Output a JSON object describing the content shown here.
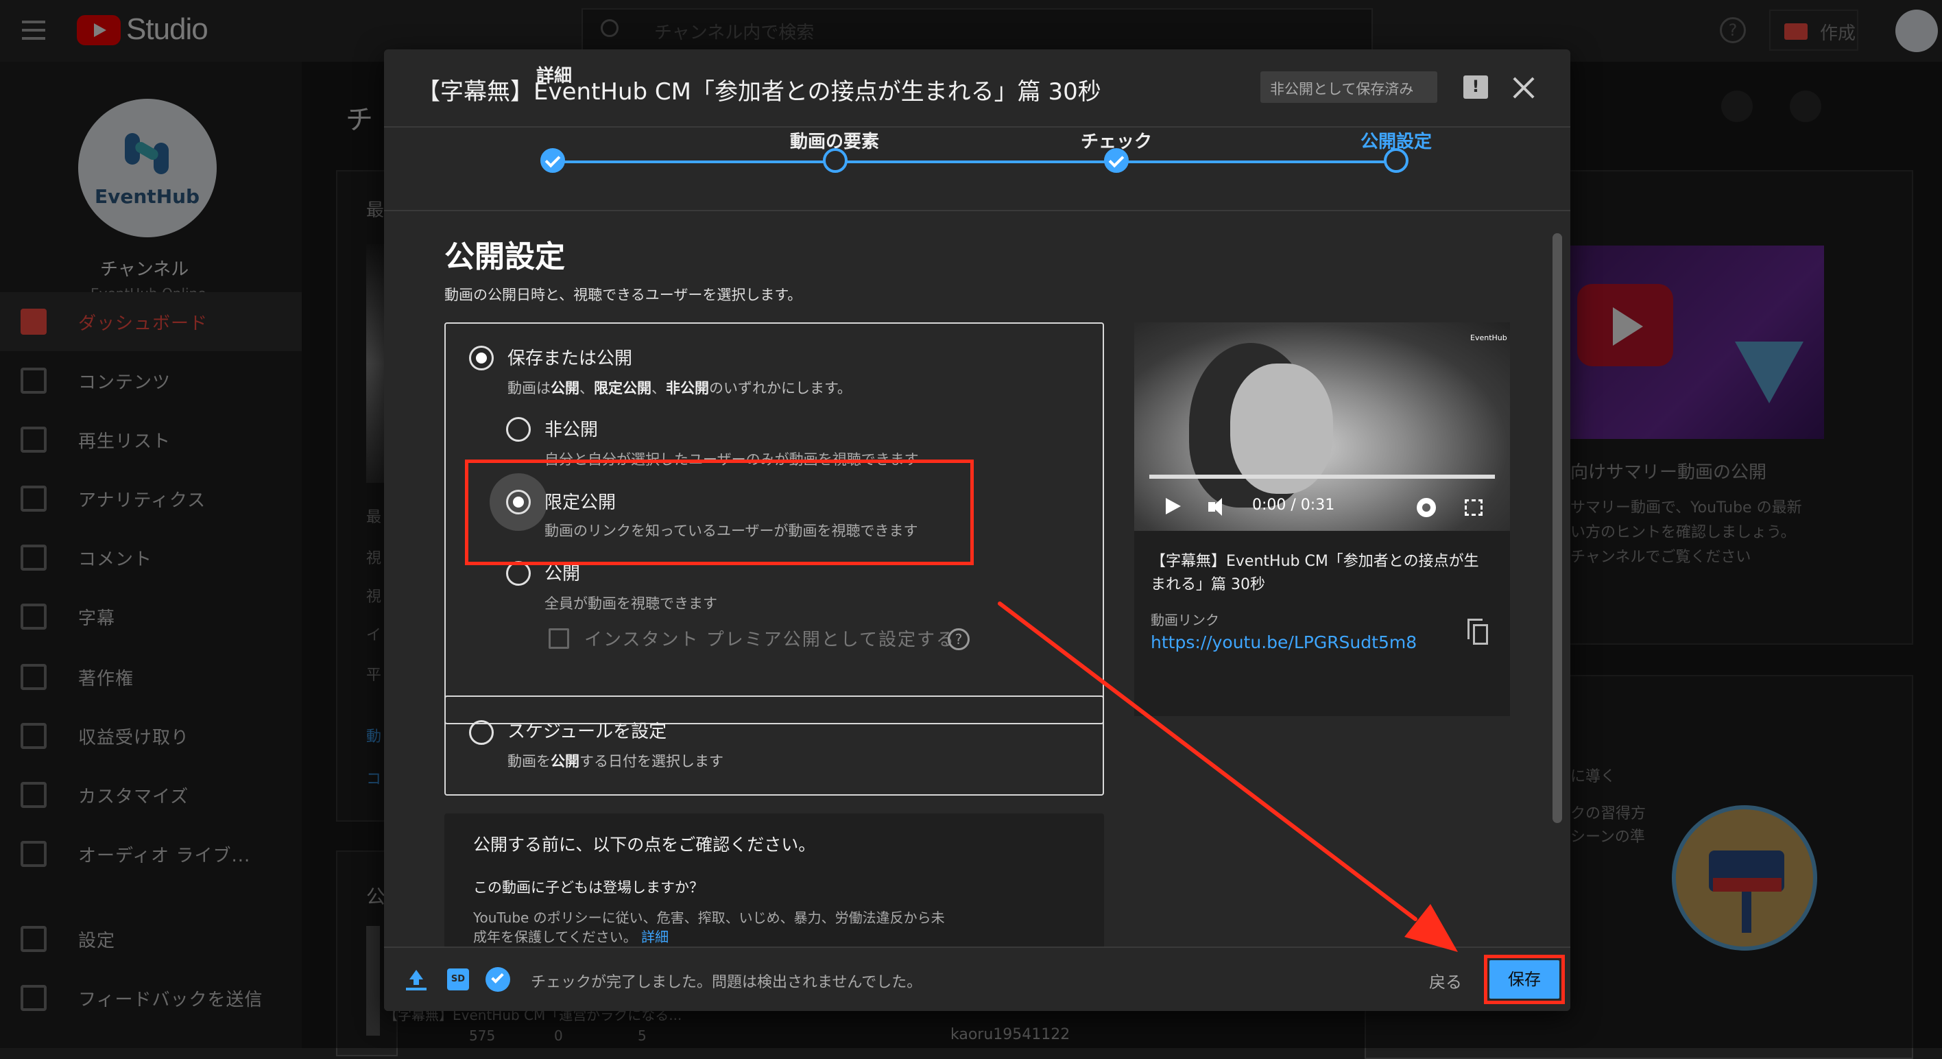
{
  "app": {
    "name": "Studio",
    "search_placeholder": "チャンネル内で検索",
    "create_label": "作成"
  },
  "channel": {
    "heading": "チャンネル",
    "name": "EventHub Online",
    "logo_text": "EventHub"
  },
  "background_page": {
    "title_fragment": "チ",
    "left_fragments": [
      "最",
      "最",
      "視",
      "視",
      "イ",
      "平",
      "動",
      "コ",
      "公"
    ],
    "right_card_title": "向けサマリー動画の公開",
    "right_card_text": [
      "サマリー動画で、YouTube の最新",
      "い方のヒントを確認しましょう。",
      "チャンネルでご覧ください"
    ],
    "right_card2_lines": [
      "に導く",
      "クの習得方",
      "シーンの準"
    ],
    "bottom_video_title": "【字幕無】EventHub CM「運営がラクになる...",
    "bottom_stats": [
      "575",
      "0",
      "5"
    ],
    "bottom_user": "kaoru19541122"
  },
  "sidebar": {
    "items": [
      {
        "label": "ダッシュボード",
        "icon": "dashboard-icon"
      },
      {
        "label": "コンテンツ",
        "icon": "content-icon"
      },
      {
        "label": "再生リスト",
        "icon": "playlist-icon"
      },
      {
        "label": "アナリティクス",
        "icon": "analytics-icon"
      },
      {
        "label": "コメント",
        "icon": "comment-icon"
      },
      {
        "label": "字幕",
        "icon": "subtitles-icon"
      },
      {
        "label": "著作権",
        "icon": "copyright-icon"
      },
      {
        "label": "収益受け取り",
        "icon": "dollar-icon"
      },
      {
        "label": "カスタマイズ",
        "icon": "customize-icon"
      },
      {
        "label": "オーディオ ライブ...",
        "icon": "audio-library-icon"
      },
      {
        "label": "設定",
        "icon": "gear-icon"
      },
      {
        "label": "フィードバックを送信",
        "icon": "feedback-icon"
      }
    ]
  },
  "dialog": {
    "title": "【字幕無】EventHub CM「参加者との接点が生まれる」篇 30秒",
    "saved_badge": "非公開として保存済み",
    "steps": [
      "詳細",
      "動画の要素",
      "チェック",
      "公開設定"
    ],
    "section_title": "公開設定",
    "section_desc": "動画の公開日時と、視聴できるユーザーを選択します。",
    "save_or_publish": {
      "label": "保存または公開",
      "desc_parts": [
        "動画は",
        "公開",
        "、",
        "限定公開",
        "、",
        "非公開",
        "のいずれかにします。"
      ],
      "options": [
        {
          "label": "非公開",
          "desc": "自分と自分が選択したユーザーのみが動画を視聴できます"
        },
        {
          "label": "限定公開",
          "desc": "動画のリンクを知っているユーザーが動画を視聴できます"
        },
        {
          "label": "公開",
          "desc": "全員が動画を視聴できます"
        }
      ],
      "premiere_label": "インスタント プレミア公開として設定する"
    },
    "schedule": {
      "label": "スケジュールを設定",
      "desc_parts": [
        "動画を",
        "公開",
        "する日付を選択します"
      ]
    },
    "before_publish": {
      "heading": "公開する前に、以下の点をご確認ください。",
      "question": "この動画に子どもは登場しますか？",
      "policy_line1": "YouTube のポリシーに従い、危害、搾取、いじめ、暴力、労働法違反から未",
      "policy_line2": "成年を保護してください。",
      "policy_link": "詳細"
    },
    "video": {
      "watermark": "EventHub",
      "time": "0:00 / 0:31",
      "title_line1": "【字幕無】EventHub CM「参加者との接点が生",
      "title_line2": "まれる」篇 30秒",
      "link_label": "動画リンク",
      "link": "https://youtu.be/LPGRSudt5m8"
    },
    "footer": {
      "hd_badge": "SD",
      "status": "チェックが完了しました。問題は検出されませんでした。",
      "back_label": "戻る",
      "save_label": "保存"
    }
  },
  "colors": {
    "accent": "#3ea6ff",
    "annotation": "#ff2d1a",
    "active_nav": "#ff4e45"
  }
}
